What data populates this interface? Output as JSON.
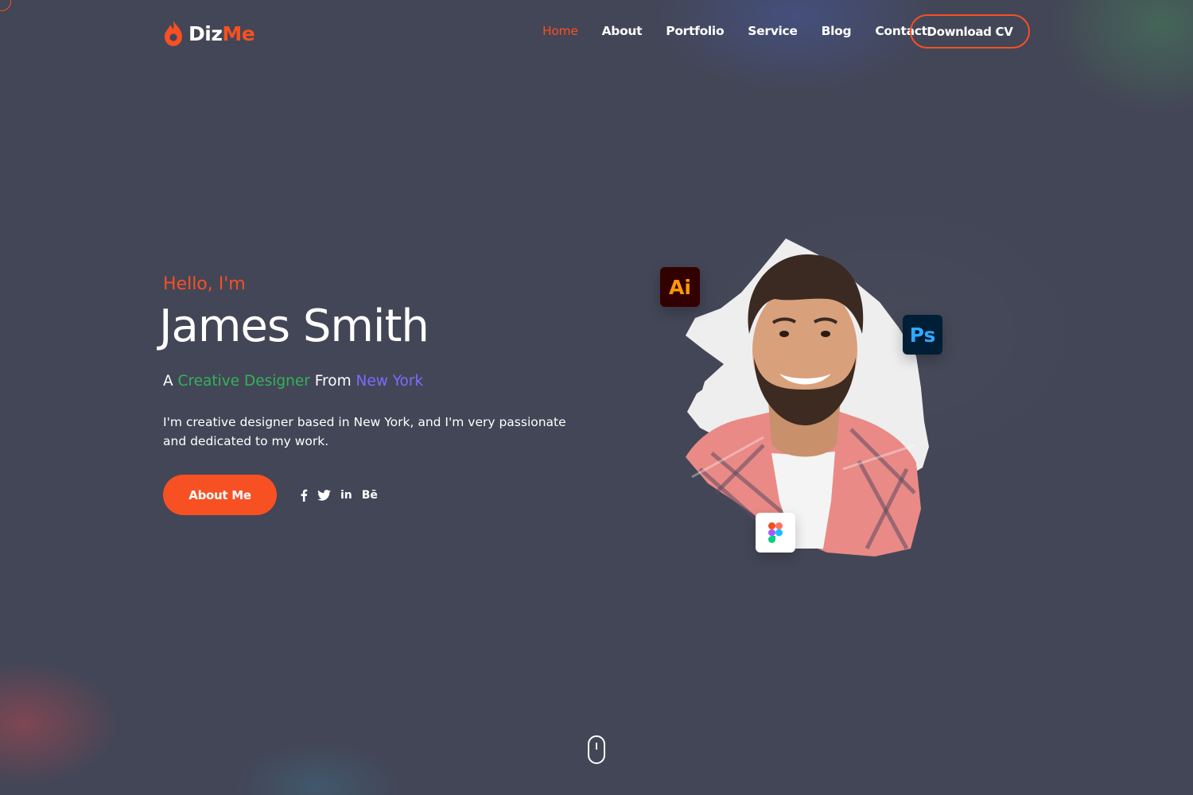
{
  "brand": {
    "name_part1": "Diz",
    "name_part2": "Me",
    "accent_color": "#f75023",
    "logo_icon": "flame-drop-icon"
  },
  "nav": {
    "items": [
      {
        "label": "Home",
        "active": true
      },
      {
        "label": "About",
        "active": false
      },
      {
        "label": "Portfolio",
        "active": false
      },
      {
        "label": "Service",
        "active": false
      },
      {
        "label": "Blog",
        "active": false
      },
      {
        "label": "Contact",
        "active": false
      }
    ],
    "cta_label": "Download CV"
  },
  "hero": {
    "greeting": "Hello, I'm",
    "name": "James Smith",
    "tagline": {
      "prefix": "A",
      "role": "Creative Designer",
      "middle": "From",
      "location": "New York",
      "role_color": "#32b35b",
      "location_color": "#7d6bff"
    },
    "description": "I'm creative designer based in New York, and I'm very passionate and dedicated to my work.",
    "button_label": "About Me",
    "socials": [
      {
        "name": "facebook-icon"
      },
      {
        "name": "twitter-icon"
      },
      {
        "name": "linkedin-icon",
        "text": "in"
      },
      {
        "name": "behance-icon",
        "text": "Bē"
      }
    ]
  },
  "portrait": {
    "badges": {
      "illustrator": {
        "text": "Ai",
        "icon": "adobe-illustrator-icon",
        "color": "#ff9a00",
        "bg": "#330000"
      },
      "photoshop": {
        "text": "Ps",
        "icon": "adobe-photoshop-icon",
        "color": "#31a8ff",
        "bg": "#001e36"
      },
      "figma": {
        "icon": "figma-icon"
      }
    }
  },
  "scroll_indicator": {
    "icon": "mouse-scroll-icon"
  }
}
